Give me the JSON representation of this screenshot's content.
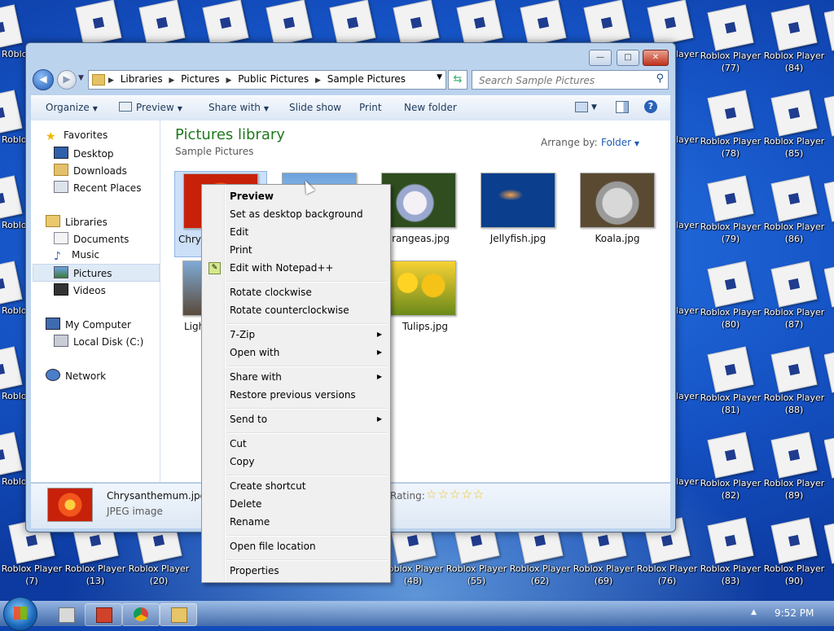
{
  "desktop": {
    "left_partial_labels": [
      "R0blox",
      "Roblo",
      "Roblo",
      "Roblo",
      "Roblo",
      "Roblo",
      "Robl"
    ],
    "right_col_partial": [
      "layer",
      "layer",
      "layer",
      "layer",
      "layer",
      "layer",
      "layer",
      "layer"
    ],
    "col77": [
      {
        "line1": "Roblox Player",
        "line2": "(77)"
      },
      {
        "line1": "Roblox Player",
        "line2": "(78)"
      },
      {
        "line1": "Roblox Player",
        "line2": "(79)"
      },
      {
        "line1": "Roblox Player",
        "line2": "(80)"
      },
      {
        "line1": "Roblox Player",
        "line2": "(81)"
      },
      {
        "line1": "Roblox Player",
        "line2": "(82)"
      },
      {
        "line1": "Roblox Player",
        "line2": "(83)"
      }
    ],
    "col84": [
      {
        "line1": "Roblox Player",
        "line2": "(84)"
      },
      {
        "line1": "Roblox Player",
        "line2": "(85)"
      },
      {
        "line1": "Roblox Player",
        "line2": "(86)"
      },
      {
        "line1": "Roblox Player",
        "line2": "(87)"
      },
      {
        "line1": "Roblox Player",
        "line2": "(88)"
      },
      {
        "line1": "Roblox Player",
        "line2": "(89)"
      },
      {
        "line1": "Roblox Player",
        "line2": "(90)"
      }
    ],
    "bottom_row": [
      {
        "line1": "Roblox Player",
        "line2": "(7)"
      },
      {
        "line1": "Roblox Player",
        "line2": "(13)"
      },
      {
        "line1": "Roblox Player",
        "line2": "(20)"
      },
      {
        "line1": "Roblox Player",
        "line2": "(48)"
      },
      {
        "line1": "Roblox Player",
        "line2": "(55)"
      },
      {
        "line1": "Roblox Player",
        "line2": "(62)"
      },
      {
        "line1": "Roblox Player",
        "line2": "(69)"
      },
      {
        "line1": "Roblox Player",
        "line2": "(76)"
      }
    ]
  },
  "window": {
    "controls": {
      "minimize": "—",
      "maximize": "□",
      "close": "✕"
    },
    "address": {
      "crumbs": [
        "Libraries",
        "Pictures",
        "Public Pictures",
        "Sample Pictures"
      ]
    },
    "search": {
      "placeholder": "Search Sample Pictures"
    },
    "toolbar": {
      "organize": "Organize",
      "preview": "Preview",
      "share_with": "Share with",
      "slide_show": "Slide show",
      "print": "Print",
      "new_folder": "New folder"
    },
    "navpane": {
      "favorites": "Favorites",
      "desktop": "Desktop",
      "downloads": "Downloads",
      "recent_places": "Recent Places",
      "libraries": "Libraries",
      "documents": "Documents",
      "music": "Music",
      "pictures": "Pictures",
      "videos": "Videos",
      "my_computer": "My Computer",
      "local_disk": "Local Disk (C:)",
      "network": "Network"
    },
    "content": {
      "title": "Pictures library",
      "subtitle": "Sample Pictures",
      "arrange_label": "Arrange by:",
      "arrange_value": "Folder",
      "files": [
        "Chrys",
        "",
        "ydrangeas.jpg",
        "Jellyfish.jpg",
        "Koala.jpg",
        "Ligh",
        "Tulips.jpg"
      ]
    },
    "details": {
      "name": "Chrysanthemum.jpg",
      "type": "JPEG image",
      "rating_label": "Rating:",
      "stars": "☆☆☆☆☆"
    }
  },
  "context_menu": {
    "items": [
      "Preview",
      "Set as desktop background",
      "Edit",
      "Print",
      "Edit with Notepad++",
      "Rotate clockwise",
      "Rotate counterclockwise",
      "7-Zip",
      "Open with",
      "Share with",
      "Restore previous versions",
      "Send to",
      "Cut",
      "Copy",
      "Create shortcut",
      "Delete",
      "Rename",
      "Open file location",
      "Properties"
    ]
  },
  "taskbar": {
    "time": "9:52 PM",
    "tray_arrow": "▲"
  },
  "colors": {
    "library_title": "#1e7a1e",
    "link_blue": "#1e5ab8",
    "desktop_blue": "#1e5fd6"
  }
}
